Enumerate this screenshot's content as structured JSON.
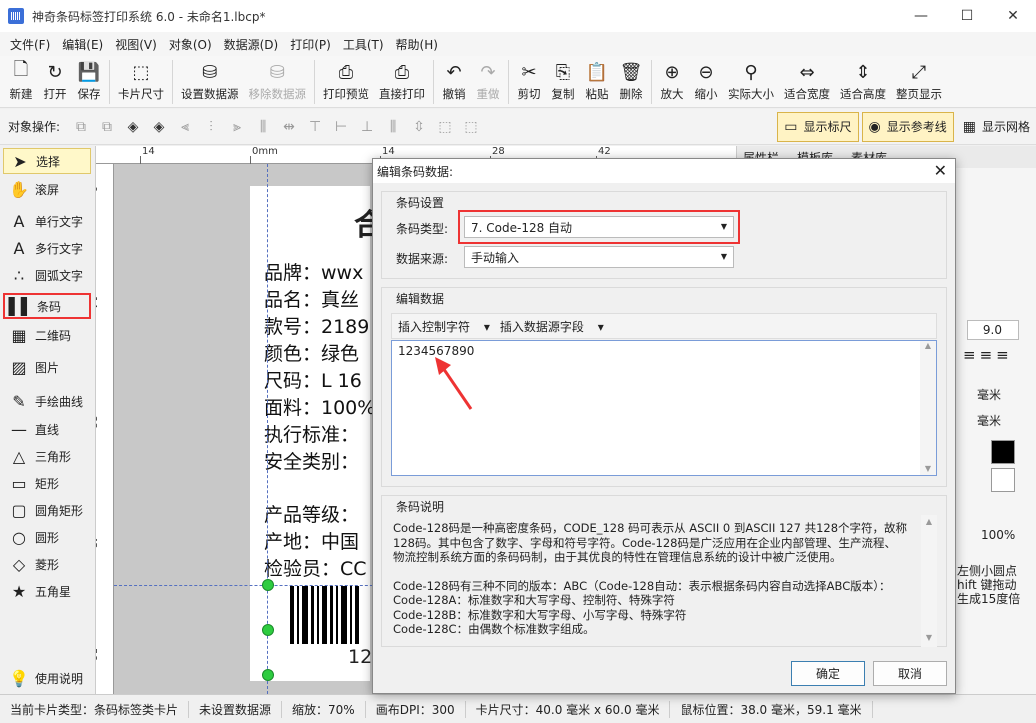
{
  "window": {
    "title": "神奇条码标签打印系统 6.0 - 未命名1.lbcp*",
    "controls": [
      "—",
      "☐",
      "✕"
    ]
  },
  "menu": [
    "文件(F)",
    "编辑(E)",
    "视图(V)",
    "对象(O)",
    "数据源(D)",
    "打印(P)",
    "工具(T)",
    "帮助(H)"
  ],
  "toolbar": [
    {
      "label": "新建",
      "icon": "new-file-icon",
      "glyph": "🗋"
    },
    {
      "label": "打开",
      "icon": "open-icon",
      "glyph": "↻"
    },
    {
      "label": "保存",
      "icon": "save-icon",
      "glyph": "💾"
    },
    {
      "label": "卡片尺寸",
      "icon": "card-size-icon",
      "glyph": "⬚"
    },
    {
      "label": "设置数据源",
      "icon": "database-icon",
      "glyph": "⛁"
    },
    {
      "label": "移除数据源",
      "icon": "database-remove-icon",
      "glyph": "⛁",
      "disabled": true
    },
    {
      "label": "打印预览",
      "icon": "print-preview-icon",
      "glyph": "⎙"
    },
    {
      "label": "直接打印",
      "icon": "printer-icon",
      "glyph": "⎙"
    },
    {
      "label": "撤销",
      "icon": "undo-icon",
      "glyph": "↶"
    },
    {
      "label": "重做",
      "icon": "redo-icon",
      "glyph": "↷",
      "disabled": true
    },
    {
      "label": "剪切",
      "icon": "cut-icon",
      "glyph": "✂"
    },
    {
      "label": "复制",
      "icon": "copy-icon",
      "glyph": "⎘"
    },
    {
      "label": "粘贴",
      "icon": "paste-icon",
      "glyph": "📋"
    },
    {
      "label": "删除",
      "icon": "delete-icon",
      "glyph": "🗑"
    },
    {
      "label": "放大",
      "icon": "zoom-in-icon",
      "glyph": "⊕"
    },
    {
      "label": "缩小",
      "icon": "zoom-out-icon",
      "glyph": "⊖"
    },
    {
      "label": "实际大小",
      "icon": "actual-size-icon",
      "glyph": "⚲"
    },
    {
      "label": "适合宽度",
      "icon": "fit-width-icon",
      "glyph": "⇔"
    },
    {
      "label": "适合高度",
      "icon": "fit-height-icon",
      "glyph": "⇕"
    },
    {
      "label": "整页显示",
      "icon": "fit-page-icon",
      "glyph": "⤢"
    }
  ],
  "objbar": {
    "label": "对象操作:",
    "show_ruler": "显示标尺",
    "show_guides": "显示参考线",
    "show_grid": "显示网格"
  },
  "tools": [
    {
      "label": "选择",
      "icon": "cursor-icon",
      "glyph": "➤",
      "selected": true
    },
    {
      "label": "滚屏",
      "icon": "hand-icon",
      "glyph": "✋"
    },
    {
      "label": "单行文字",
      "icon": "single-line-text-icon",
      "glyph": "A"
    },
    {
      "label": "多行文字",
      "icon": "multi-line-text-icon",
      "glyph": "A"
    },
    {
      "label": "圆弧文字",
      "icon": "arc-text-icon",
      "glyph": "∴"
    },
    {
      "label": "条码",
      "icon": "barcode-icon",
      "glyph": "▌▌",
      "highlighted": true
    },
    {
      "label": "二维码",
      "icon": "qrcode-icon",
      "glyph": "▦"
    },
    {
      "label": "图片",
      "icon": "image-icon",
      "glyph": "▨"
    },
    {
      "label": "手绘曲线",
      "icon": "pen-icon",
      "glyph": "✎"
    },
    {
      "label": "直线",
      "icon": "line-icon",
      "glyph": "—"
    },
    {
      "label": "三角形",
      "icon": "triangle-icon",
      "glyph": "△"
    },
    {
      "label": "矩形",
      "icon": "rectangle-icon",
      "glyph": "▭"
    },
    {
      "label": "圆角矩形",
      "icon": "rounded-rect-icon",
      "glyph": "▢"
    },
    {
      "label": "圆形",
      "icon": "circle-icon",
      "glyph": "○"
    },
    {
      "label": "菱形",
      "icon": "diamond-icon",
      "glyph": "◇"
    },
    {
      "label": "五角星",
      "icon": "star-icon",
      "glyph": "★"
    },
    {
      "label": "使用说明",
      "icon": "lightbulb-icon",
      "glyph": "💡"
    }
  ],
  "ruler": {
    "h_labels": [
      "14",
      "0mm",
      "14",
      "28",
      "42"
    ],
    "v_labels": [
      "0",
      "14",
      "28",
      "42",
      "56"
    ]
  },
  "label_content": {
    "title_char": "合",
    "lines": [
      "品牌：wwx",
      "品名：真丝",
      "款号：2189",
      "颜色：绿色",
      "尺码：L 16",
      "面料：100%",
      "执行标准：",
      "安全类别：",
      "产品等级：",
      "产地：中国",
      "检验员：CC"
    ],
    "barcode_text": "12"
  },
  "right_panel": {
    "tabs": [
      "属性栏",
      "模板库",
      "素材库"
    ],
    "font_size": "9.0",
    "unit1": "毫米",
    "unit2": "毫米",
    "percent": "100%",
    "tip_lines": [
      "左侧小圆点",
      "hift 键拖动",
      "生成15度倍"
    ]
  },
  "status": {
    "card_type": "当前卡片类型：条码标签类卡片",
    "data_source": "未设置数据源",
    "zoom": "缩放：70%",
    "dpi": "画布DPI：300",
    "card_size": "卡片尺寸：40.0 毫米 x 60.0 毫米",
    "mouse_pos": "鼠标位置：38.0 毫米，59.1 毫米"
  },
  "dialog": {
    "title": "编辑条码数据:",
    "group_settings": "条码设置",
    "type_label": "条码类型:",
    "type_value": "7. Code-128 自动",
    "source_label": "数据来源:",
    "source_value": "手动输入",
    "group_edit": "编辑数据",
    "insert_ctrl": "插入控制字符",
    "insert_field": "插入数据源字段",
    "data_value": "1234567890",
    "group_desc": "条码说明",
    "desc_lines_1": [
      "Code-128码是一种高密度条码，CODE_128 码可表示从 ASCII 0 到ASCII 127 共128个字符，故称",
      "128码。其中包含了数字、字母和符号字符。Code-128码是广泛应用在企业内部管理、生产流程、",
      "物流控制系统方面的条码码制，由于其优良的特性在管理信息系统的设计中被广泛使用。"
    ],
    "desc_lines_2": [
      "Code-128码有三种不同的版本：ABC（Code-128自动：表示根据条码内容自动选择ABC版本）：",
      "Code-128A：标准数字和大写字母、控制符、特殊字符",
      "Code-128B：标准数字和大写字母、小写字母、特殊字符",
      "Code-128C：由偶数个标准数字组成。"
    ],
    "ok": "确定",
    "cancel": "取消"
  },
  "colors": {
    "highlight_red": "#e33333",
    "handle_green": "#2ecc40",
    "selection_yellow": "#fff8c9"
  }
}
